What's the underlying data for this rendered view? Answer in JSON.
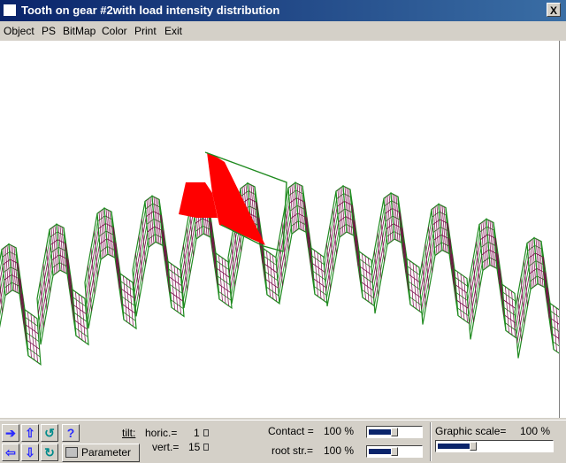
{
  "window": {
    "title": "Tooth on gear #2with load intensity distribution",
    "close_glyph": "X"
  },
  "menu": [
    {
      "label": "Object"
    },
    {
      "label": "PS"
    },
    {
      "label": "BitMap"
    },
    {
      "label": "Color"
    },
    {
      "label": "Print"
    },
    {
      "label": "Exit"
    }
  ],
  "toolbar": {
    "help_glyph": "?",
    "parameter_label": "Parameter",
    "tilt": {
      "label": "tilt:",
      "horiz_label": "horic.=",
      "horiz_value": "1",
      "vert_label": "vert.=",
      "vert_value": "15"
    },
    "contact": {
      "label": "Contact =",
      "value": "100 %",
      "level": 1.0
    },
    "root": {
      "label": "root str.=",
      "value": "100 %",
      "level": 1.0
    },
    "scale": {
      "label": "Graphic scale=",
      "value": "100 %",
      "level": 1.0
    }
  },
  "colors": {
    "mesh": "#1f8a1f",
    "mesh_lines": "#7a0a4a",
    "load": "#ff0000",
    "title": "#0a246a"
  }
}
